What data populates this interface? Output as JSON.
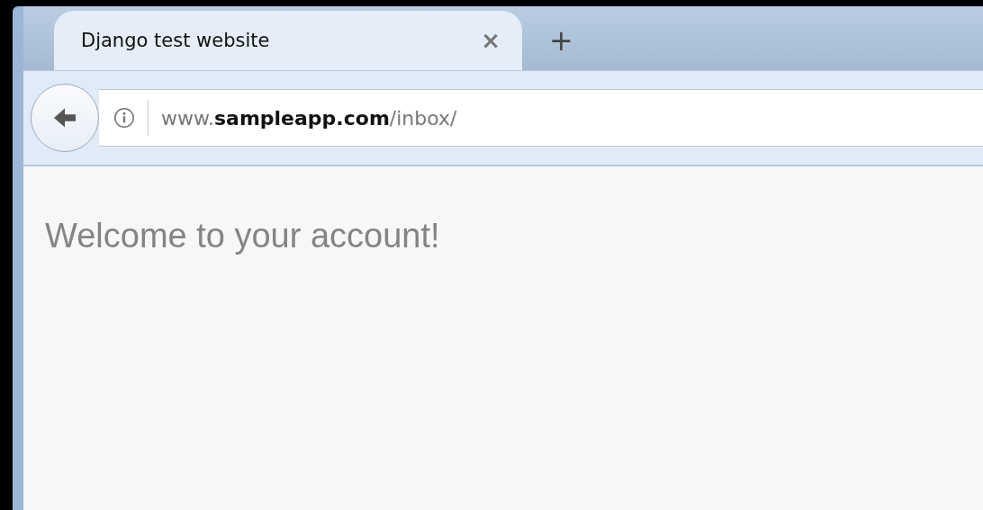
{
  "tabs": [
    {
      "label": "Django test website",
      "selected": true,
      "close": "×"
    }
  ],
  "new_tab": "+",
  "address_bar": {
    "url": "www.**sampleapp.com**/inbox/"
  },
  "page": {
    "heading": "Welcome to your account!"
  }
}
